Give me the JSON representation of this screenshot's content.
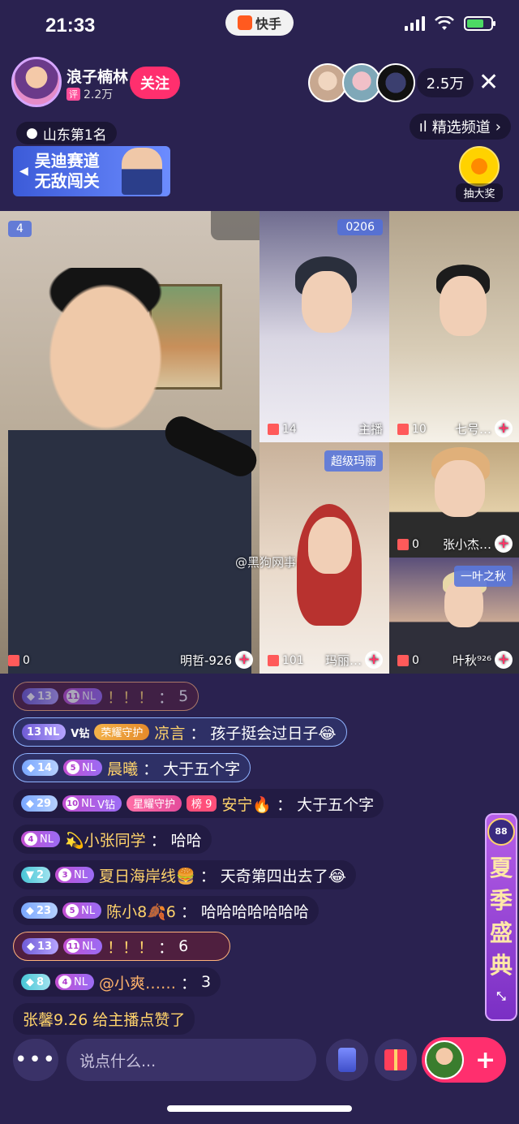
{
  "status": {
    "time": "21:33",
    "app_name": "快手"
  },
  "host": {
    "name": "浪子楠林",
    "fans_tag": "评",
    "fans": "2.2万",
    "follow_label": "关注"
  },
  "viewers": {
    "count": "2.5万"
  },
  "rank_line": "山东第1名",
  "channel": {
    "label": "精选频道",
    "chevron": "›"
  },
  "banner": {
    "line1": "吴迪赛道",
    "line2": "无敌闯关"
  },
  "lottery": {
    "label": "抽大奖"
  },
  "video": {
    "main": {
      "badge": "4",
      "gifts": "0",
      "name": "明哲-926"
    },
    "tiles": [
      {
        "badge": "0206",
        "gifts": "14",
        "name": "主播"
      },
      {
        "gifts": "10",
        "name": "七号…"
      },
      {
        "tag": "超级玛丽",
        "gifts": "101",
        "name": "玛丽…"
      },
      {
        "gifts": "0",
        "name": "张小杰…"
      },
      {
        "tag": "一叶之秋",
        "gifts": "0",
        "name": "叶秋⁹²⁶"
      }
    ]
  },
  "watermark": "@黑狗网事",
  "chat": [
    {
      "lv": "13",
      "nl": "11",
      "user": "！！！",
      "text": "5"
    },
    {
      "lv": "13",
      "nl_text": "NL",
      "vip": "V钻",
      "badge": "荣耀守护",
      "user": "凉言",
      "text": "孩子挺会过日子😂"
    },
    {
      "lv": "14",
      "nl": "5",
      "user": "晨曦",
      "text": "大于五个字"
    },
    {
      "lv": "29",
      "nl": "10",
      "vip": "V钻",
      "badge": "星耀守护",
      "rank": "榜 9",
      "user": "安宁🔥",
      "text": "大于五个字"
    },
    {
      "nl": "4",
      "user": "💫小张同学",
      "text": "哈哈"
    },
    {
      "lv": "2",
      "nl": "3",
      "user": "夏日海岸线🍔",
      "text": "天奇第四出去了😂"
    },
    {
      "lv": "23",
      "nl": "5",
      "user": "陈小8🍂6",
      "text": "哈哈哈哈哈哈哈"
    },
    {
      "lv": "13",
      "nl": "11",
      "user": "！！！",
      "text": "6"
    },
    {
      "lv": "8",
      "nl": "4",
      "user": "@小爽……",
      "text": "3"
    }
  ],
  "like_message": "张馨9.26 给主播点赞了",
  "event_banner": {
    "text": [
      "夏",
      "季",
      "盛",
      "典"
    ],
    "badge": "88"
  },
  "bottom": {
    "more": "•••",
    "input_placeholder": "说点什么..."
  }
}
